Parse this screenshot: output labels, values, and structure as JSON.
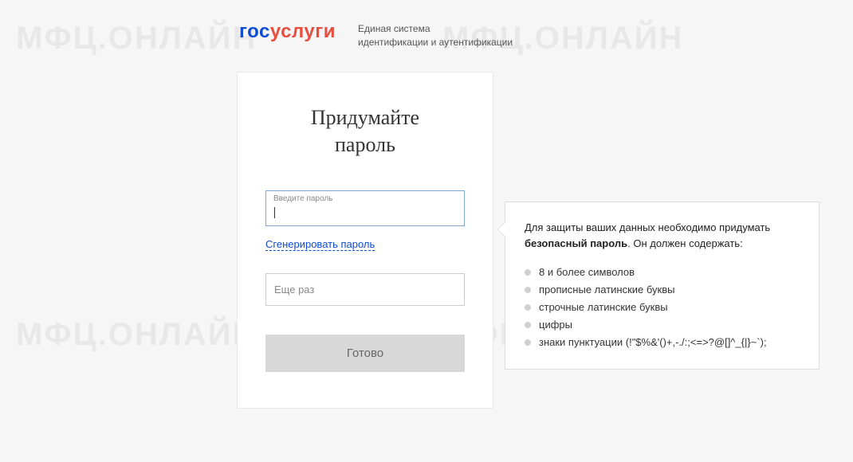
{
  "watermark": "МФЦ.ОНЛАЙН",
  "header": {
    "logo_gos": "гос",
    "logo_uslugi": "услуги",
    "tagline_line1": "Единая система",
    "tagline_line2": "идентификации и аутентификации"
  },
  "form": {
    "title_line1": "Придумайте",
    "title_line2": "пароль",
    "password_label": "Введите пароль",
    "confirm_placeholder": "Еще раз",
    "generate_link": "Сгенерировать пароль",
    "submit_label": "Готово"
  },
  "tooltip": {
    "text_prefix": "Для защиты ваших данных необходимо придумать ",
    "text_bold": "безопасный пароль",
    "text_suffix": ". Он должен содержать:",
    "requirements": [
      "8 и более символов",
      "прописные латинские буквы",
      "строчные латинские буквы",
      "цифры",
      "знаки пунктуации (!\"$%&'()+,-./:;<=>?@[]^_{|}~`);"
    ]
  }
}
